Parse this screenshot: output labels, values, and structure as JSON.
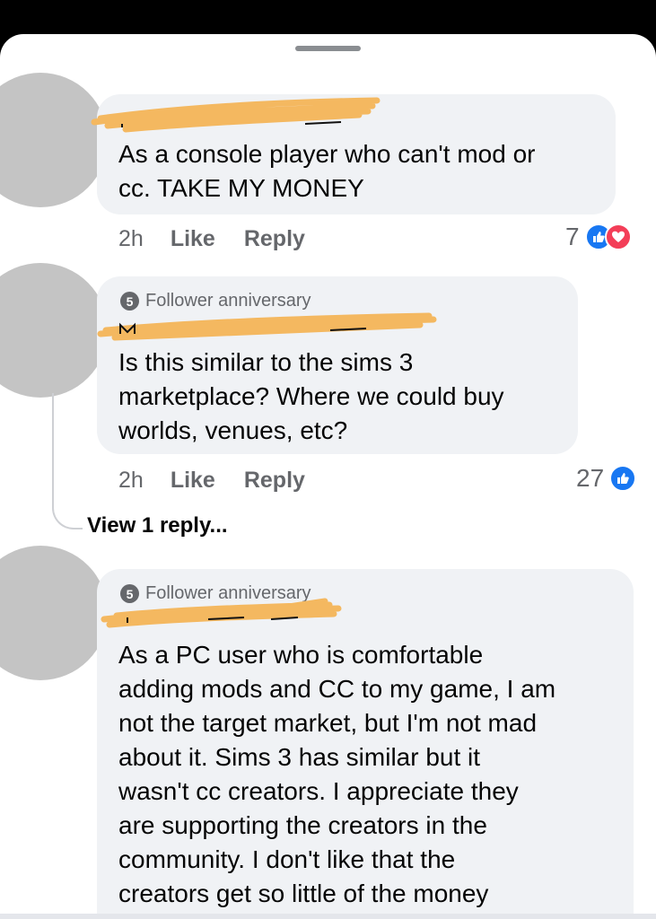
{
  "theme": {
    "like_blue": "#1877f2",
    "love_red": "#f33e58",
    "bubble_bg": "#f0f2f5",
    "meta_gray": "#65676b",
    "redaction_orange": "#f4b860"
  },
  "comments": [
    {
      "text": "As a console player who can't mod or\ncc. TAKE MY MONEY",
      "time": "2h",
      "like_label": "Like",
      "reply_label": "Reply",
      "reaction_count": "7",
      "reactions": [
        "like-icon",
        "love-icon"
      ]
    },
    {
      "badge_number": "5",
      "badge_label": "Follower anniversary",
      "text": "Is this similar to the sims 3\nmarketplace? Where we could buy\nworlds, venues, etc?",
      "time": "2h",
      "like_label": "Like",
      "reply_label": "Reply",
      "reaction_count": "27",
      "reactions": [
        "like-icon"
      ],
      "view_replies": "View 1 reply..."
    },
    {
      "badge_number": "5",
      "badge_label": "Follower anniversary",
      "text": "As a PC user who is comfortable\nadding mods and CC to my game, I am\nnot the target market, but I'm not mad\nabout it. Sims 3 has similar but it\nwasn't cc creators. I appreciate they\nare supporting the creators in the\ncommunity. I don't like that the\ncreators get so little of the money"
    }
  ]
}
